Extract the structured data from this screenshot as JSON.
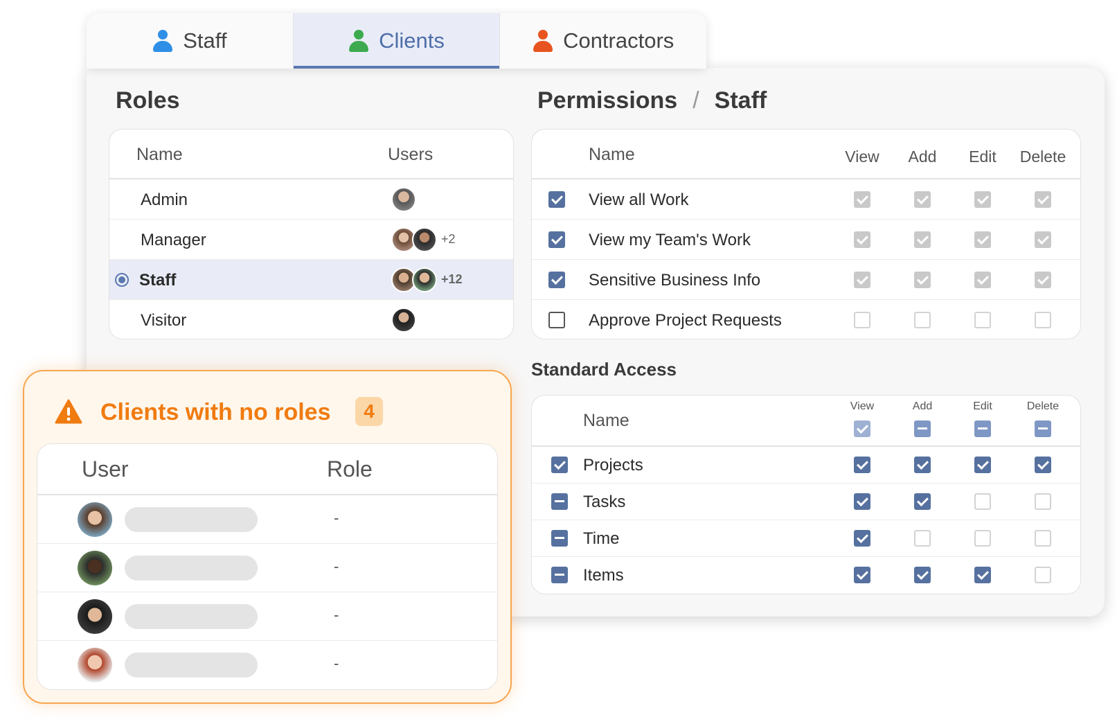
{
  "tabs": [
    {
      "label": "Staff",
      "icon": "person-icon",
      "color": "#2f8fe6"
    },
    {
      "label": "Clients",
      "icon": "person-icon",
      "color": "#3daa4f",
      "active": true
    },
    {
      "label": "Contractors",
      "icon": "person-icon",
      "color": "#e8541f"
    }
  ],
  "roles": {
    "title": "Roles",
    "col_name": "Name",
    "col_users": "Users",
    "rows": [
      {
        "name": "Admin",
        "extra": ""
      },
      {
        "name": "Manager",
        "extra": "+2"
      },
      {
        "name": "Staff",
        "extra": "+12",
        "selected": true
      },
      {
        "name": "Visitor",
        "extra": ""
      }
    ]
  },
  "permissions": {
    "title": "Permissions",
    "separator": "/",
    "role": "Staff",
    "col_name": "Name",
    "col_view": "View",
    "col_add": "Add",
    "col_edit": "Edit",
    "col_delete": "Delete",
    "rows": [
      {
        "label": "View all Work",
        "checked": true
      },
      {
        "label": "View my Team's Work",
        "checked": true
      },
      {
        "label": "Sensitive Business Info",
        "checked": true
      },
      {
        "label": "Approve Project Requests",
        "checked": false
      }
    ]
  },
  "standard_access": {
    "title": "Standard Access",
    "col_name": "Name",
    "col_view": "View",
    "col_add": "Add",
    "col_edit": "Edit",
    "col_delete": "Delete",
    "rows": [
      {
        "label": "Projects",
        "state": "checked",
        "view": true,
        "add": true,
        "edit": true,
        "delete": true
      },
      {
        "label": "Tasks",
        "state": "indeterminate",
        "view": true,
        "add": true,
        "edit": false,
        "delete": false
      },
      {
        "label": "Time",
        "state": "indeterminate",
        "view": true,
        "add": false,
        "edit": false,
        "delete": false
      },
      {
        "label": "Items",
        "state": "indeterminate",
        "view": true,
        "add": true,
        "edit": true,
        "delete": false
      }
    ]
  },
  "no_roles": {
    "title": "Clients with no roles",
    "count": "4",
    "col_user": "User",
    "col_role": "Role",
    "rows": [
      {
        "role": "-"
      },
      {
        "role": "-"
      },
      {
        "role": "-"
      },
      {
        "role": "-"
      }
    ]
  },
  "colors": {
    "accent": "#56719f",
    "warning": "#f07b10",
    "selected_bg": "#e9ecf7"
  }
}
